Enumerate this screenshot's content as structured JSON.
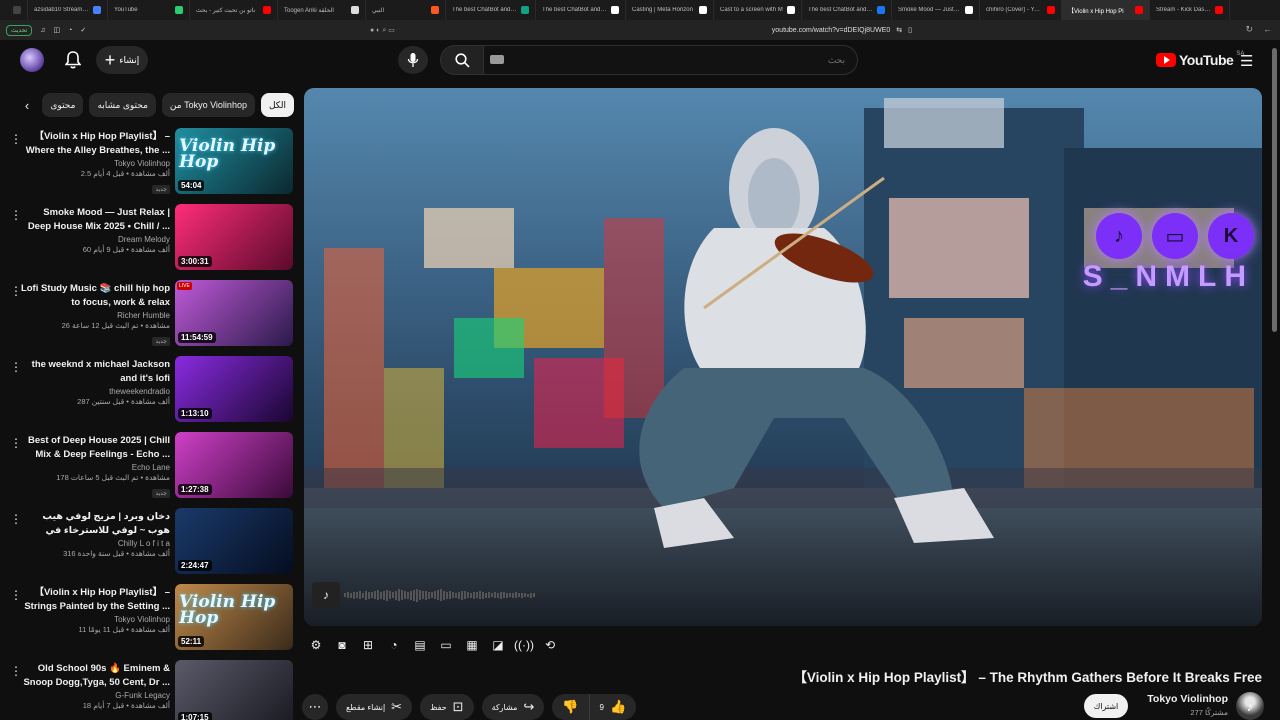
{
  "browser": {
    "tabs": [
      {
        "title": "",
        "color": "#444"
      },
      {
        "title": "azsidab10 Stream - Wa",
        "color": "#4a7fff"
      },
      {
        "title": "YouTube",
        "color": "#2ecc71"
      },
      {
        "title": "ناتو بن تحبت كتير - بحث",
        "color": "#ff0000"
      },
      {
        "title": "Toogen Anki الحلقة",
        "color": "#dddddd"
      },
      {
        "title": "النبي",
        "color": "#ff5722"
      },
      {
        "title": "The best ChatBot and W",
        "color": "#10a37f"
      },
      {
        "title": "The best ChatBot and W",
        "color": "#ffffff"
      },
      {
        "title": "Casting | Meta Horizon",
        "color": "#ffffff"
      },
      {
        "title": "Cast to a screen with M",
        "color": "#ffffff"
      },
      {
        "title": "The best ChatBot and W",
        "color": "#1877f2"
      },
      {
        "title": "Smoke Mood — Just Re",
        "color": "#ffffff"
      },
      {
        "title": "chihiro (Cover) - YouTub",
        "color": "#ff0000"
      },
      {
        "title": "【Violin x Hip Hop Pl",
        "color": "#ff0000"
      },
      {
        "title": "Stream - Kick Dashboard",
        "color": "#ff0000"
      }
    ],
    "update_label": "تحديث",
    "url": "youtube.com/watch?v=dDEIQj8UWE0"
  },
  "header": {
    "create_label": "إنشاء",
    "search_placeholder": "بحث",
    "logo_text": "YouTube",
    "logo_country": "SA"
  },
  "chips": [
    {
      "label": "الكل",
      "active": true
    },
    {
      "label": "من Tokyo Violinhop",
      "active": false
    },
    {
      "label": "محتوى مشابه",
      "active": false
    },
    {
      "label": "محتوى",
      "active": false
    }
  ],
  "recommendations": [
    {
      "title": "【Violin x Hip Hop Playlist】 – Where the Alley Breathes, the ...",
      "channel": "Tokyo Violinhop",
      "stats": "2.5 ألف مشاهدة • قبل 4 أيام",
      "badge": "جديد",
      "duration": "54:04",
      "thumb_label": "Violin Hip Hop",
      "c1": "#1f8fa0",
      "c2": "#0b2830"
    },
    {
      "title": "Smoke Mood — Just Relax | Deep House Mix 2025 • Chill / ...",
      "channel": "Dream Melody",
      "stats": "60 ألف مشاهدة • قبل 9 أيام",
      "badge": "",
      "duration": "3:00:31",
      "thumb_label": "",
      "c1": "#ff2d7a",
      "c2": "#5a0a2a"
    },
    {
      "title": "Lofi Study Music 📚 chill hip hop to focus, work & relax",
      "channel": "Richer Humble",
      "stats": "26 مشاهدة • تم البث قبل 12 ساعة",
      "badge": "جديد",
      "duration": "11:54:59",
      "thumb_label": "",
      "c1": "#c05ad8",
      "c2": "#2a1a4a",
      "live": "LIVE"
    },
    {
      "title": "the weeknd x michael Jackson and it's lofi",
      "channel": "theweekendradio",
      "stats": "287 ألف مشاهدة • قبل سنتين",
      "badge": "",
      "duration": "1:13:10",
      "thumb_label": "",
      "c1": "#8a2be2",
      "c2": "#1a0630"
    },
    {
      "title": "Best of Deep House 2025 | Chill Mix & Deep Feelings - Echo ...",
      "channel": "Echo Lane",
      "stats": "178 مشاهدة • تم البث قبل 5 ساعات",
      "badge": "جديد",
      "duration": "1:27:38",
      "thumb_label": "",
      "c1": "#d040c8",
      "c2": "#3a0a3a"
    },
    {
      "title": "دخان وبرد | مزيج لوفي هيب هوب ~ لوفي للاسترخاء في الليل",
      "channel": "Chilly L o f i t a",
      "stats": "316 ألف مشاهدة • قبل سنة واحدة",
      "badge": "",
      "duration": "2:24:47",
      "thumb_label": "",
      "c1": "#1a3a6a",
      "c2": "#050d20"
    },
    {
      "title": "【Violin x Hip Hop Playlist】 – Strings Painted by the Setting ...",
      "channel": "Tokyo Violinhop",
      "stats": "11 ألف مشاهدة • قبل 11 يومًا",
      "badge": "",
      "duration": "52:11",
      "thumb_label": "Violin Hip Hop",
      "c1": "#c08a4a",
      "c2": "#3a2a1a"
    },
    {
      "title": "Old School 90s 🔥 Eminem & Snoop Dogg,Tyga, 50 Cent, Dr ...",
      "channel": "G-Funk Legacy",
      "stats": "18 ألف مشاهدة • قبل 7 أيام",
      "badge": "",
      "duration": "1:07:15",
      "thumb_label": "",
      "c1": "#5a5a6a",
      "c2": "#1a1a22"
    }
  ],
  "video": {
    "title": "【Violin x Hip Hop Playlist】 – The Rhythm Gathers Before It Breaks Free",
    "brand_name": "S_NMLH",
    "social_labels": [
      "TikTok",
      "Twitch",
      "Kick"
    ]
  },
  "actions": {
    "likes": "9",
    "share_label": "مشاركة",
    "save_label": "حفظ",
    "clip_label": "إنشاء مقطع"
  },
  "channel": {
    "name": "Tokyo Violinhop",
    "subscribers": "277 مشتركًا",
    "subscribe_label": "اشتراك"
  },
  "colors": {
    "background": "#0f0f0f",
    "chip": "#272727",
    "brand_red": "#ff0000",
    "accent_purple": "#7b2ff7"
  }
}
